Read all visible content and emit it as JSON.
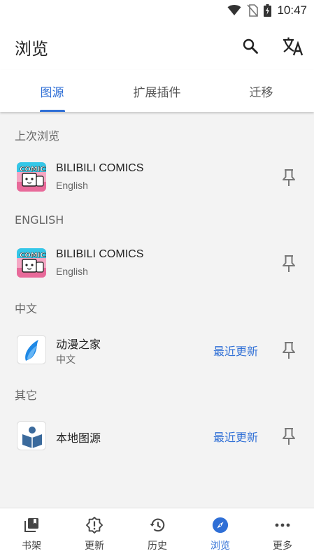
{
  "status_bar": {
    "time": "10:47"
  },
  "app_bar": {
    "title": "浏览"
  },
  "tabs": [
    {
      "label": "图源",
      "active": true
    },
    {
      "label": "扩展插件",
      "active": false
    },
    {
      "label": "迁移",
      "active": false
    }
  ],
  "sections": [
    {
      "header": "上次浏览",
      "items": [
        {
          "title": "BILIBILI COMICS",
          "subtitle": "English",
          "latest": ""
        }
      ]
    },
    {
      "header": "ENGLISH",
      "items": [
        {
          "title": "BILIBILI COMICS",
          "subtitle": "English",
          "latest": ""
        }
      ]
    },
    {
      "header": "中文",
      "items": [
        {
          "title": "动漫之家",
          "subtitle": "中文",
          "latest": "最近更新"
        }
      ]
    },
    {
      "header": "其它",
      "items": [
        {
          "title": "本地图源",
          "subtitle": "",
          "latest": "最近更新"
        }
      ]
    }
  ],
  "bottom_nav": [
    {
      "label": "书架",
      "icon": "library-icon",
      "active": false
    },
    {
      "label": "更新",
      "icon": "updates-icon",
      "active": false
    },
    {
      "label": "历史",
      "icon": "history-icon",
      "active": false
    },
    {
      "label": "浏览",
      "icon": "compass-icon",
      "active": true
    },
    {
      "label": "更多",
      "icon": "more-icon",
      "active": false
    }
  ],
  "colors": {
    "accent": "#2f6fd6",
    "background": "#f3f3f3",
    "surface": "#ffffff"
  }
}
